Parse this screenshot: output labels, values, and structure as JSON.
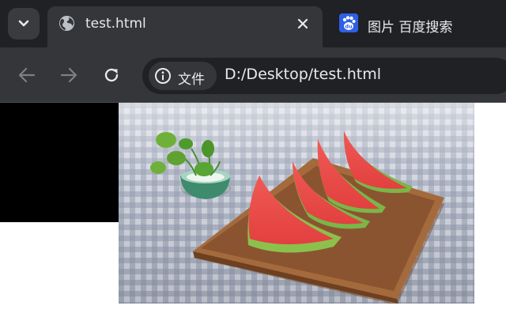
{
  "tabs": {
    "active": {
      "title": "test.html",
      "favicon": "globe-icon"
    },
    "inactive": {
      "title": "图片 百度搜索",
      "favicon": "baidu-paw-icon"
    }
  },
  "toolbar": {
    "site_info_label": "文件",
    "url": "D:/Desktop/test.html"
  },
  "content": {
    "image_description": "watermelon-slices-on-wooden-tray"
  },
  "colors": {
    "tabstrip_bg": "#202124",
    "toolbar_bg": "#35363a",
    "omnibox_bg": "#202124",
    "text": "#e8eaed",
    "baidu_blue": "#2f5fe8"
  }
}
